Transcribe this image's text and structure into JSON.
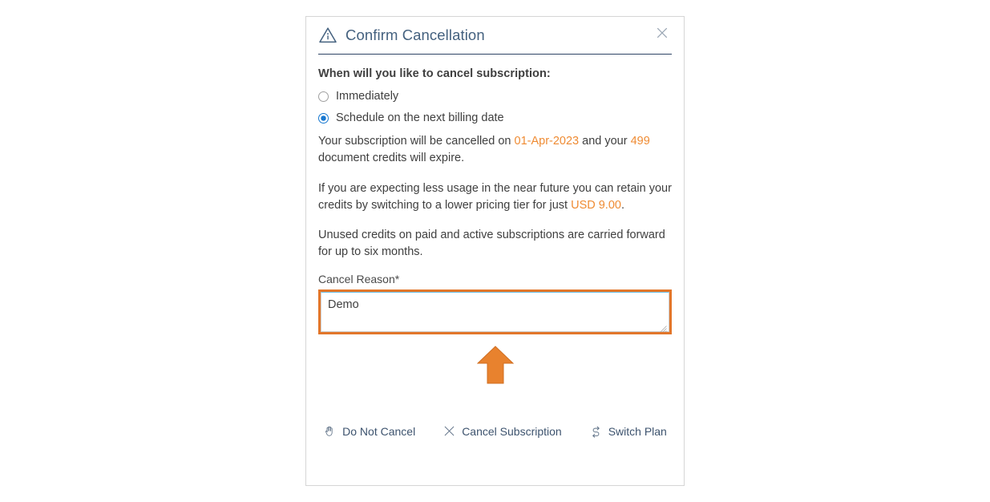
{
  "dialog": {
    "title": "Confirm Cancellation",
    "warning_icon": "warning-triangle-info-icon",
    "close_icon": "close-icon",
    "question_label": "When will you like to cancel subscription:",
    "options": [
      {
        "label": "Immediately",
        "selected": false
      },
      {
        "label": "Schedule on the next billing date",
        "selected": true
      }
    ],
    "paragraphs": {
      "cancel_notice": {
        "part1": "Your subscription will be cancelled on ",
        "date": "01-Apr-2023",
        "part2": " and your ",
        "credits": "499",
        "part3": " document credits will expire."
      },
      "retain_offer": {
        "part1": "If you are expecting less usage in the near future you can retain your credits by switching to a lower pricing tier for just ",
        "price": "USD 9.00",
        "part2": "."
      },
      "carry_forward": "Unused credits on paid and active subscriptions are carried forward for up to six months."
    },
    "reason_field": {
      "label": "Cancel Reason*",
      "value": "Demo",
      "placeholder": ""
    },
    "footer_actions": [
      {
        "label": "Do Not Cancel",
        "icon": "hand-stop-icon"
      },
      {
        "label": "Cancel Subscription",
        "icon": "close-x-icon"
      },
      {
        "label": "Switch Plan",
        "icon": "swap-arrows-icon"
      }
    ]
  },
  "annotations": {
    "arrow": "orange-up-arrow-pointer",
    "highlight_box": "orange-highlight-rectangle"
  },
  "colors": {
    "accent_orange": "#ef8b33",
    "annotation_orange": "#e2762a",
    "title_blue": "#44617f",
    "radio_blue": "#1778d0",
    "focus_blue": "#6ec1e8",
    "text_gray": "#3f3f3f",
    "footer_text": "#3d536e"
  }
}
